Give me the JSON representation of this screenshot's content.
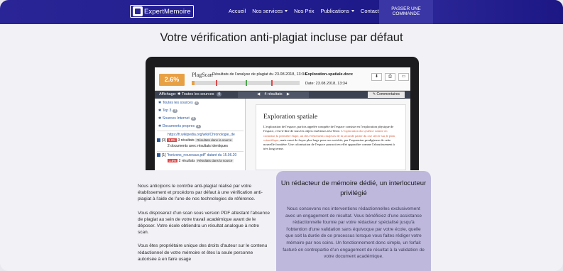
{
  "header": {
    "logo_text": "ExpertMemoire",
    "nav": [
      {
        "label": "Accueil",
        "has_dropdown": false
      },
      {
        "label": "Nos services",
        "has_dropdown": true
      },
      {
        "label": "Nos Prix",
        "has_dropdown": false
      },
      {
        "label": "Publications",
        "has_dropdown": true
      },
      {
        "label": "Contact",
        "has_dropdown": false
      }
    ],
    "order_button": "PASSER UNE COMMANDE",
    "colors": {
      "bg": "#2a2596",
      "text": "#ffffff"
    }
  },
  "page_title": "Votre vérification anti-plagiat incluse par défaut",
  "plagscan": {
    "score": "2.6%",
    "brand": "PlagScan",
    "results_title": "Résultats de l'analyse de plagiat du 23.08.2018, 13:34",
    "doc_name": "Exploration-spatiale.docx",
    "date": "Date: 23.08.2018, 13:34",
    "score_fraction": 0.026,
    "filter": {
      "label": "Affichage:",
      "value": "Toutes les sources",
      "count": "4"
    },
    "pager": "4 résultats",
    "comments_label": "Commentaires",
    "sources": [
      {
        "label": "Toutes les sources",
        "count": "4"
      },
      {
        "label": "Top 3",
        "count": "3"
      },
      {
        "label": "Sources Internet",
        "count": "3"
      },
      {
        "label": "Documents propres",
        "count": "1"
      }
    ],
    "results": [
      {
        "index": "[0]",
        "url": "https://fr.wikipedia.org/wiki/Chronologie_de",
        "pct": "1.8%",
        "matches": "3 résultats",
        "badge": "Résultats dans la source",
        "extra": "2 documents avec résultats identiques"
      },
      {
        "index": "[1]",
        "url": "\"horizons_nouveaux.pdf\" datant du 15.06.20",
        "pct": "1.8%",
        "matches": "2 résultats",
        "badge": "Résultats dans la source",
        "extra": ""
      }
    ],
    "document": {
      "title": "Exploration spatiale",
      "body_before": "L'exploration de l'espace, parfois appelée conquête de l'espace consiste en l'exploration physique de l'espace, c'est-à-dire de tous les objets extérieurs à la Terre. ",
      "body_highlight": "L'exploration du système solaire en constitue la première étape, un des évènements majeurs de la seconde partie du xxe siècle sur le plan scientifique",
      "body_after": ", mais aussi de façon plus large pour nos sociétés, par l'expansion prodigieuse de cette nouvelle frontière. Une colonisation de l'espace pourrait en effet apparaître comme l'aboutissement à très long terme."
    }
  },
  "left_text": {
    "p1": "Nous anticipons le contrôle anti-plagiat réalisé par votre établissement et procédons par défaut à une vérification anti-plagiat à l'aide de l'une de nos technologies de référence.",
    "p2": "Vous disposerez d'un scan sous version PDF attestant l'absence de plagiat au sein de votre travail académique avant de le déposer. Votre école obtiendra un résultat analogue à notre scan.",
    "p3": "Vous êtes propriétaire unique des droits d'auteur sur le contenu rédactionnel de votre mémoire et êtes la seule personne autorisée à en faire usage"
  },
  "card": {
    "title": "Un rédacteur de mémoire dédié, un interlocuteur privilégié",
    "body": "Nous concevons nos interventions rédactionnelles exclusivement avec un engagement de résultat. Vous bénéficiez d'une assistance rédactionnelle fournie par votre rédacteur spécialisé jusqu'à l'obtention d'une validation sans équivoque par votre école, quelle que soit la durée de ce processus lorsque vous faites rédiger votre mémoire par nos soins. Un fonctionnement donc simple, un forfait facturé en contrepartie d'un engagement de résultat à la validation de votre document académique."
  }
}
